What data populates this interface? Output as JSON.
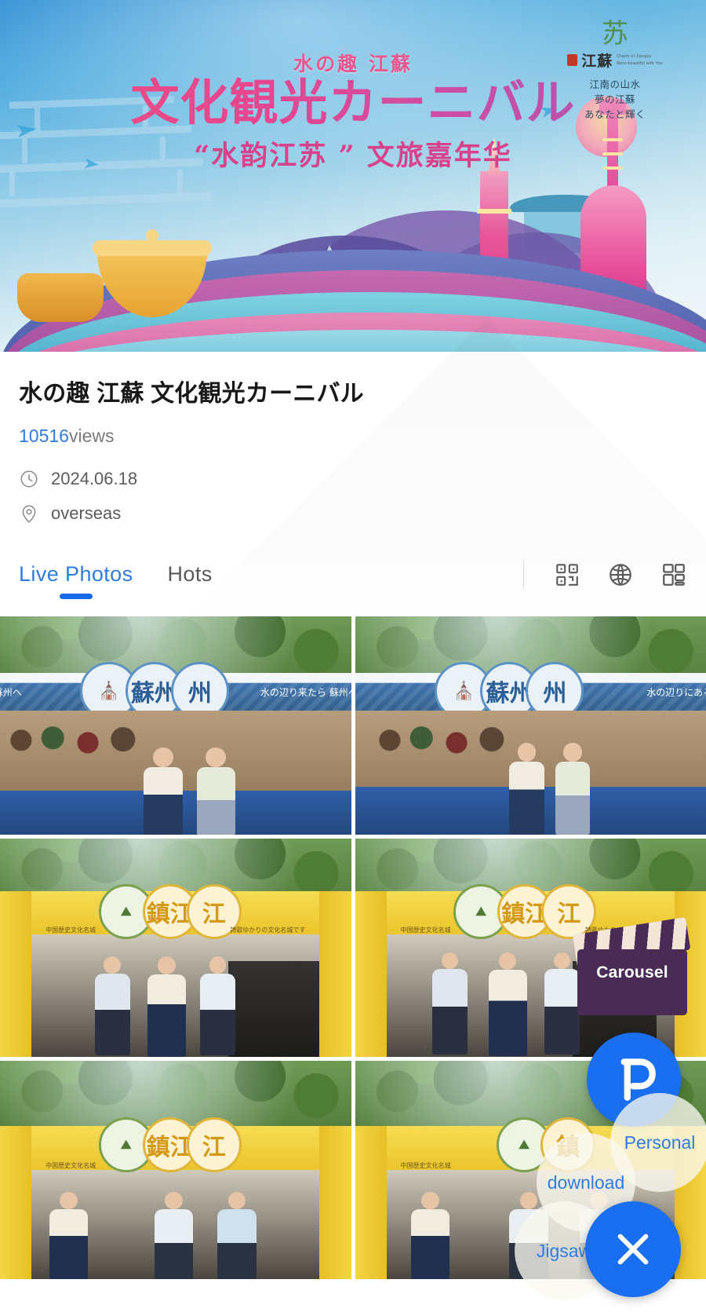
{
  "hero": {
    "kicker": "水の趣 江蘇",
    "main_title": "文化観光カーニバル",
    "subtitle": "“水韵江苏 ” 文旅嘉年华",
    "logo": {
      "mark": "苏",
      "brand_cn": "江蘇",
      "brand_en_line1": "Charm of Jiangsu",
      "brand_en_line2": "More beautiful with You",
      "tagline_line1": "江南の山水",
      "tagline_line2": "夢の江蘇",
      "tagline_line3": "あなたと輝く"
    }
  },
  "detail": {
    "title": "水の趣 江蘇 文化観光カーニバル",
    "views_count": "10516",
    "views_label": "views",
    "date": "2024.06.18",
    "location": "overseas",
    "clock_icon": "clock-icon",
    "pin_icon": "location-pin-icon"
  },
  "tabs": {
    "items": [
      {
        "label": "Live Photos",
        "active": true
      },
      {
        "label": "Hots",
        "active": false
      }
    ],
    "tools": [
      {
        "name": "qr-code-icon"
      },
      {
        "name": "globe-icon"
      },
      {
        "name": "grid-layout-icon"
      }
    ]
  },
  "gallery": {
    "photos": [
      {
        "alt": "Suzhou booth with two hostesses",
        "booth": "蘇州",
        "style": "blue",
        "banner_left": "蘇州へ",
        "banner_right": "水の辺り来たら 蘇州へ"
      },
      {
        "alt": "Suzhou booth wide view with two hostesses",
        "booth": "蘇州",
        "style": "blue",
        "banner_left": "",
        "banner_right": "水の辺りにある"
      },
      {
        "alt": "Zhenjiang booth with three staff",
        "booth": "鎮江",
        "style": "yellow",
        "banner_left": "中国歴史文化名城",
        "banner_right": "詩歌ゆかりの文化名城です"
      },
      {
        "alt": "Zhenjiang booth group photo",
        "booth": "鎮江",
        "style": "yellow",
        "banner_left": "中国歴史文化名城",
        "banner_right": "詩歌ゆかりの文化名城です"
      },
      {
        "alt": "Zhenjiang booth visitors talking",
        "booth": "鎮江",
        "style": "yellow",
        "banner_left": "中国歴史文化名城",
        "banner_right": ""
      },
      {
        "alt": "Zhenjiang booth conversation close view",
        "booth": "鎮",
        "style": "yellow",
        "banner_left": "中国歴史文化名城",
        "banner_right": ""
      }
    ]
  },
  "fab": {
    "carousel_label": "Carousel",
    "logo_label": "brand-logo",
    "download_label": "download",
    "personal_label": "Personal",
    "jigsaw_label": "Jigsaw",
    "close_label": "close"
  },
  "colors": {
    "accent_blue": "#1a6ef0",
    "tab_active": "#2f7ce0",
    "views_blue": "#2f7ce0",
    "carousel_purple": "#4a2b56",
    "banner_pink": "#e8468e"
  }
}
